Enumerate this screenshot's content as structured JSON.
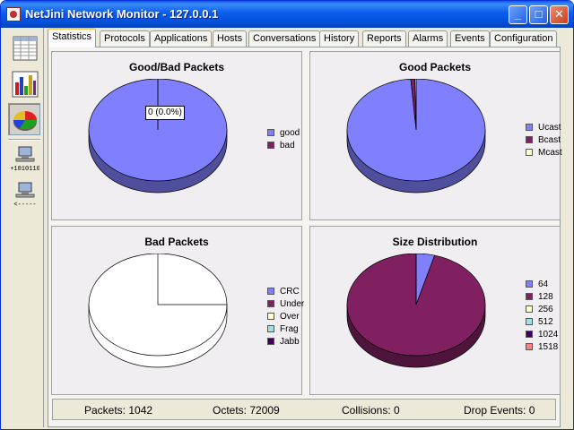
{
  "window": {
    "title": "NetJini Network Monitor - 127.0.0.1",
    "controls": {
      "minimize": "_",
      "maximize": "□",
      "close": "✕"
    }
  },
  "toolbar": {
    "tools": [
      {
        "name": "table-view",
        "icon": "table-icon"
      },
      {
        "name": "bar-chart-view",
        "icon": "bar-chart-icon"
      },
      {
        "name": "pie-chart-view",
        "icon": "pie-chart-icon",
        "active": true
      },
      {
        "name": "send-packets",
        "icon": "network-send-icon",
        "caption": "+1010110"
      },
      {
        "name": "receive-packets",
        "icon": "network-receive-icon",
        "caption": "<-----"
      }
    ]
  },
  "tabs": [
    {
      "label": "Statistics",
      "active": true
    },
    {
      "label": "Protocols"
    },
    {
      "label": "Applications"
    },
    {
      "label": "Hosts"
    },
    {
      "label": "Conversations"
    },
    {
      "label": "History"
    },
    {
      "label": "Reports"
    },
    {
      "label": "Alarms"
    },
    {
      "label": "Events"
    },
    {
      "label": "Configuration"
    }
  ],
  "chart_data": [
    {
      "type": "pie",
      "title": "Good/Bad Packets",
      "series": [
        {
          "name": "good",
          "value": 1042,
          "color": "#8080ff"
        },
        {
          "name": "bad",
          "value": 0,
          "color": "#802060"
        }
      ],
      "tooltip": "0 (0.0%)"
    },
    {
      "type": "pie",
      "title": "Good Packets",
      "series": [
        {
          "name": "Ucast",
          "value": 1029,
          "color": "#8080ff"
        },
        {
          "name": "Bcast",
          "value": 10,
          "color": "#802060"
        },
        {
          "name": "Mcast",
          "value": 3,
          "color": "#ffffcc"
        }
      ]
    },
    {
      "type": "pie",
      "title": "Bad Packets",
      "series": [
        {
          "name": "CRC",
          "value": 0,
          "color": "#8080ff"
        },
        {
          "name": "Under",
          "value": 0,
          "color": "#802060"
        },
        {
          "name": "Over",
          "value": 0,
          "color": "#ffffcc"
        },
        {
          "name": "Frag",
          "value": 0,
          "color": "#a0e0e0"
        },
        {
          "name": "Jabb",
          "value": 0,
          "color": "#400060"
        }
      ]
    },
    {
      "type": "pie",
      "title": "Size Distribution",
      "series": [
        {
          "name": "64",
          "value": 45,
          "color": "#8080ff"
        },
        {
          "name": "128",
          "value": 997,
          "color": "#802060"
        },
        {
          "name": "256",
          "value": 0,
          "color": "#ffffcc"
        },
        {
          "name": "512",
          "value": 0,
          "color": "#a0e0e0"
        },
        {
          "name": "1024",
          "value": 0,
          "color": "#400060"
        },
        {
          "name": "1518",
          "value": 0,
          "color": "#ff8080"
        }
      ]
    }
  ],
  "status": {
    "packets": "Packets: 1042",
    "octets": "Octets: 72009",
    "collisions": "Collisions: 0",
    "drop_events": "Drop Events: 0"
  }
}
